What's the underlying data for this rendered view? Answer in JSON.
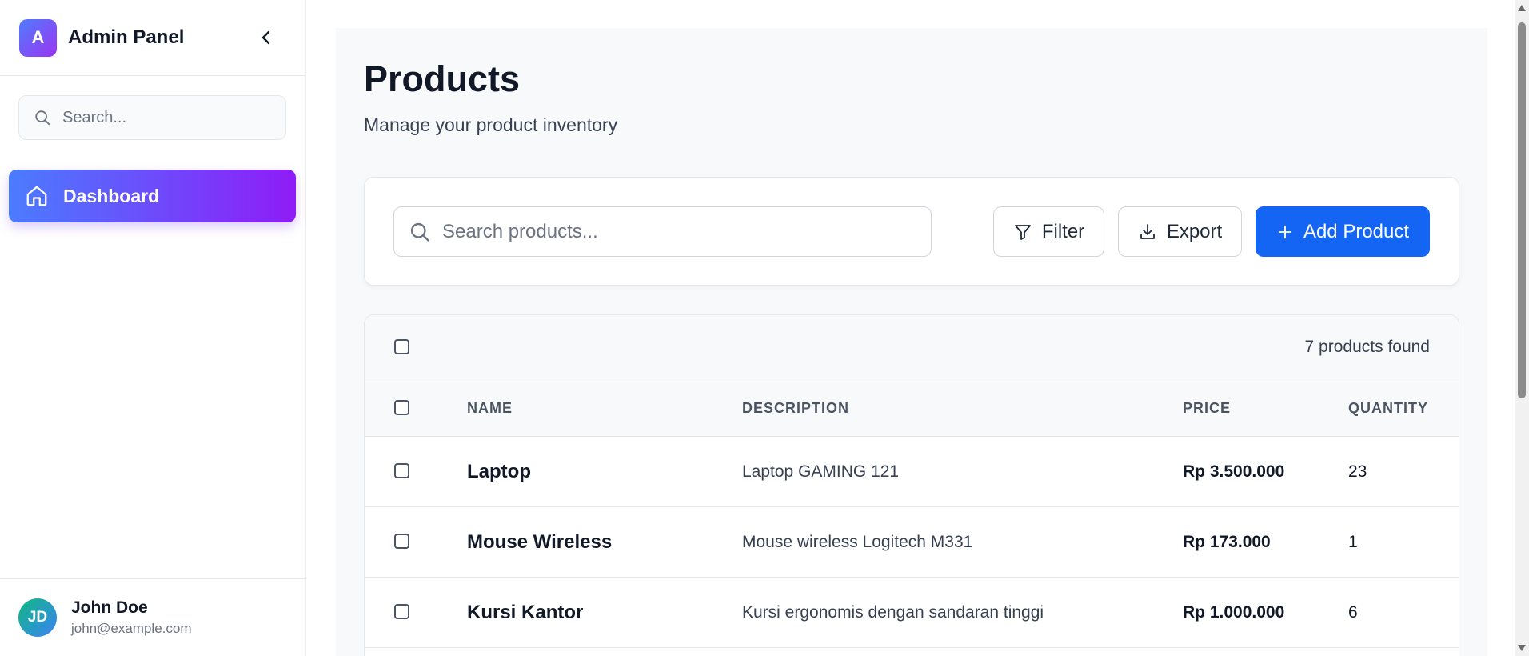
{
  "sidebar": {
    "logo_letter": "A",
    "title": "Admin Panel",
    "search_placeholder": "Search...",
    "nav": [
      {
        "label": "Dashboard",
        "icon": "home-icon",
        "active": true
      }
    ],
    "user": {
      "initials": "JD",
      "name": "John Doe",
      "email": "john@example.com"
    }
  },
  "main": {
    "title": "Products",
    "subtitle": "Manage your product inventory",
    "toolbar": {
      "search_placeholder": "Search products...",
      "filter_label": "Filter",
      "export_label": "Export",
      "add_label": "Add Product"
    },
    "table": {
      "found_text": "7 products found",
      "columns": [
        "NAME",
        "DESCRIPTION",
        "PRICE",
        "QUANTITY"
      ],
      "rows": [
        {
          "name": "Laptop",
          "description": "Laptop GAMING 121",
          "price": "Rp 3.500.000",
          "quantity": "23"
        },
        {
          "name": "Mouse Wireless",
          "description": "Mouse wireless Logitech M331",
          "price": "Rp 173.000",
          "quantity": "1"
        },
        {
          "name": "Kursi Kantor",
          "description": "Kursi ergonomis dengan sandaran tinggi",
          "price": "Rp 1.000.000",
          "quantity": "6"
        }
      ]
    }
  },
  "colors": {
    "primary": "#1565f5",
    "gradient_start": "#4a7cff",
    "gradient_end": "#8f1cf7"
  }
}
